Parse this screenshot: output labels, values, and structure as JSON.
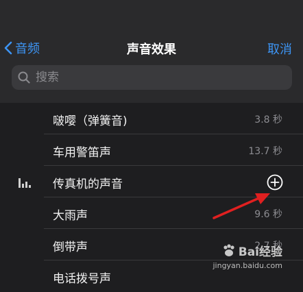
{
  "nav": {
    "back_label": "音频",
    "title": "声音效果",
    "cancel_label": "取消"
  },
  "search": {
    "placeholder": "搜索"
  },
  "items": [
    {
      "label": "啵嘤（弹簧音)",
      "duration": "3.8 秒"
    },
    {
      "label": "车用警笛声",
      "duration": "13.7 秒"
    },
    {
      "label": "传真机的声音",
      "duration": ""
    },
    {
      "label": "大雨声",
      "duration": "9.6 秒"
    },
    {
      "label": "倒带声",
      "duration": "2.7 秒"
    },
    {
      "label": "电话拨号声",
      "duration": ""
    }
  ],
  "watermark": {
    "brand": "Bai经验",
    "url": "jingyan.baidu.com"
  },
  "colors": {
    "accent": "#3d95f5",
    "header_bg": "#2a2a2c",
    "list_bg": "#1e1e20",
    "arrow": "#e02020"
  }
}
